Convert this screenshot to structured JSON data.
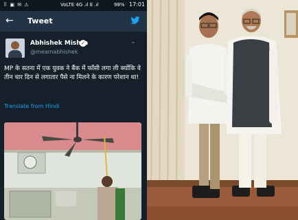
{
  "phone": {
    "status_left": "⠿ ▣ ✉ ⚠",
    "status_network": "VoLTE  4G  .ıl  E  .ıl",
    "status_battery": "98%",
    "status_time": "17:01",
    "back_glyph": "←",
    "header_title": "Tweet",
    "bird_icon": "twitter-bird-icon",
    "accent_color": "#1da1f2",
    "author_name": "Abhishek Mishra",
    "author_handle": "@meamabhishek",
    "verified_glyph": "✓",
    "menu_glyph": "⌄",
    "tweet_text": "MP के सतना में एक युवक ने बैंक में फाँसी लगा ली क्योंकि वे तीन चार दिन से लगातार पैसे ना मिलने के कारण परेशान था!",
    "translate_label": "Translate from Hindi"
  }
}
